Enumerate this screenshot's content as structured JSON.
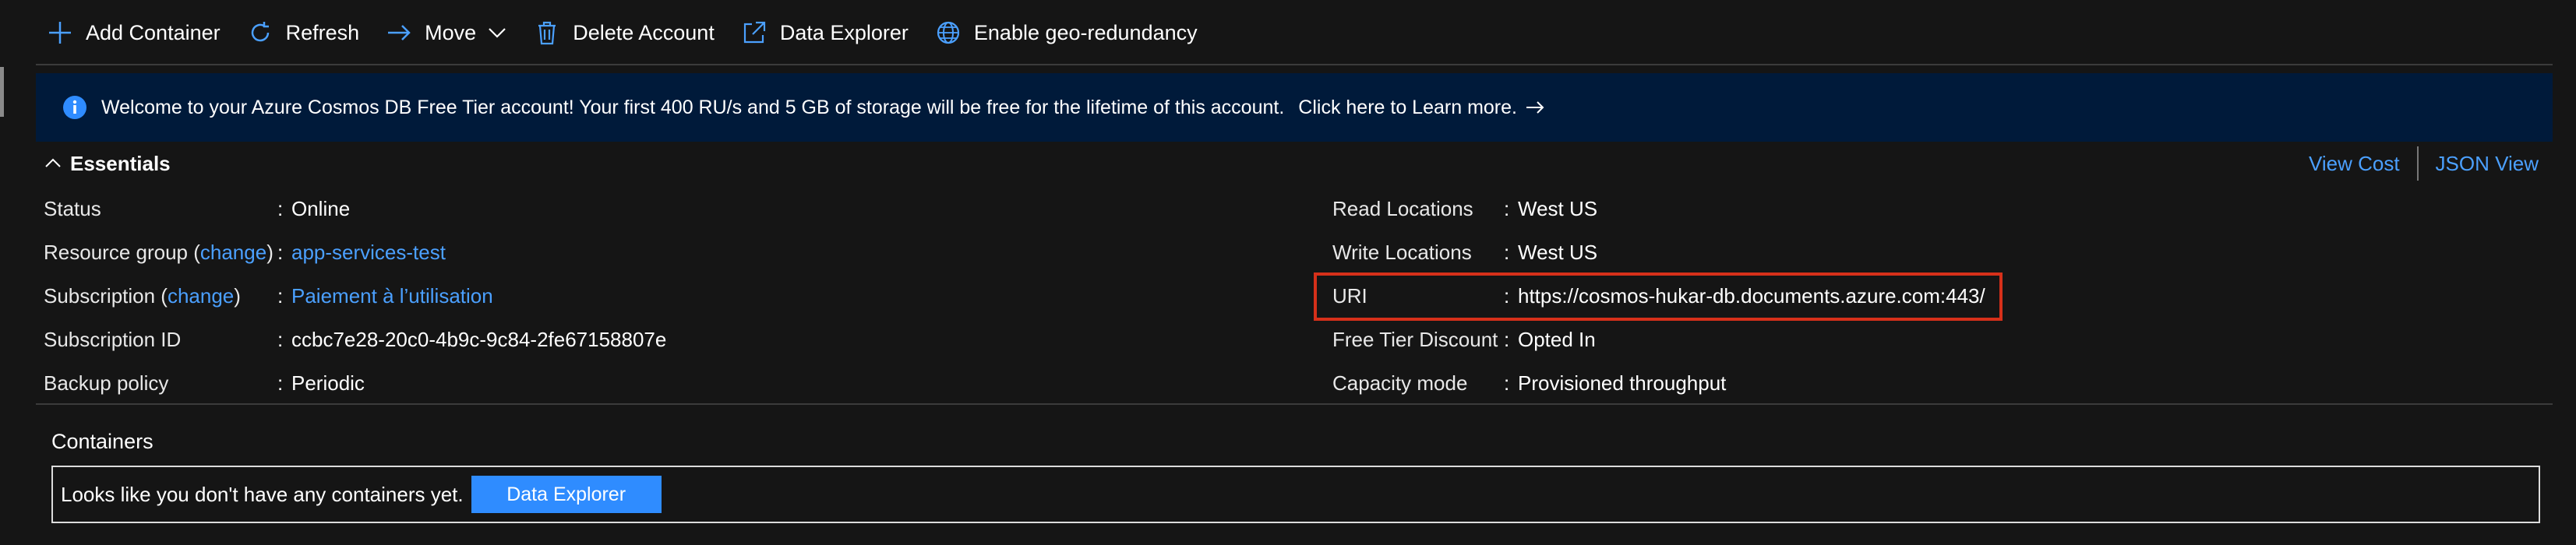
{
  "toolbar": {
    "items": [
      {
        "label": "Add Container",
        "icon": "plus-icon"
      },
      {
        "label": "Refresh",
        "icon": "refresh-icon"
      },
      {
        "label": "Move",
        "icon": "arrow-right-icon"
      },
      {
        "label": "Delete Account",
        "icon": "trash-icon"
      },
      {
        "label": "Data Explorer",
        "icon": "external-link-icon"
      },
      {
        "label": "Enable geo-redundancy",
        "icon": "globe-icon"
      }
    ]
  },
  "banner": {
    "message": "Welcome to your Azure Cosmos DB Free Tier account! Your first 400 RU/s and 5 GB of storage will be free for the lifetime of this account.",
    "link": "Click here to Learn more."
  },
  "essentials": {
    "title": "Essentials",
    "view_cost": "View Cost",
    "json_view": "JSON View",
    "left": [
      {
        "label": "Status",
        "value": "Online"
      },
      {
        "label": "Resource group",
        "change": "change",
        "value": "app-services-test"
      },
      {
        "label": "Subscription",
        "change": "change",
        "value": "Paiement à l’utilisation"
      },
      {
        "label": "Subscription ID",
        "value": "ccbc7e28-20c0-4b9c-9c84-2fe67158807e"
      },
      {
        "label": "Backup policy",
        "value": "Periodic"
      }
    ],
    "right": [
      {
        "label": "Read Locations",
        "value": "West US"
      },
      {
        "label": "Write Locations",
        "value": "West US"
      },
      {
        "label": "URI",
        "value": "https://cosmos-hukar-db.documents.azure.com:443/"
      },
      {
        "label": "Free Tier Discount",
        "value": "Opted In"
      },
      {
        "label": "Capacity mode",
        "value": "Provisioned throughput"
      }
    ]
  },
  "containers": {
    "title": "Containers",
    "empty_message": "Looks like you don't have any containers yet.",
    "button": "Data Explorer"
  },
  "colors": {
    "accent": "#4ba0ff",
    "banner_bg": "#001a3a",
    "highlight": "#d6301a",
    "button_bg": "#2f8cff"
  }
}
